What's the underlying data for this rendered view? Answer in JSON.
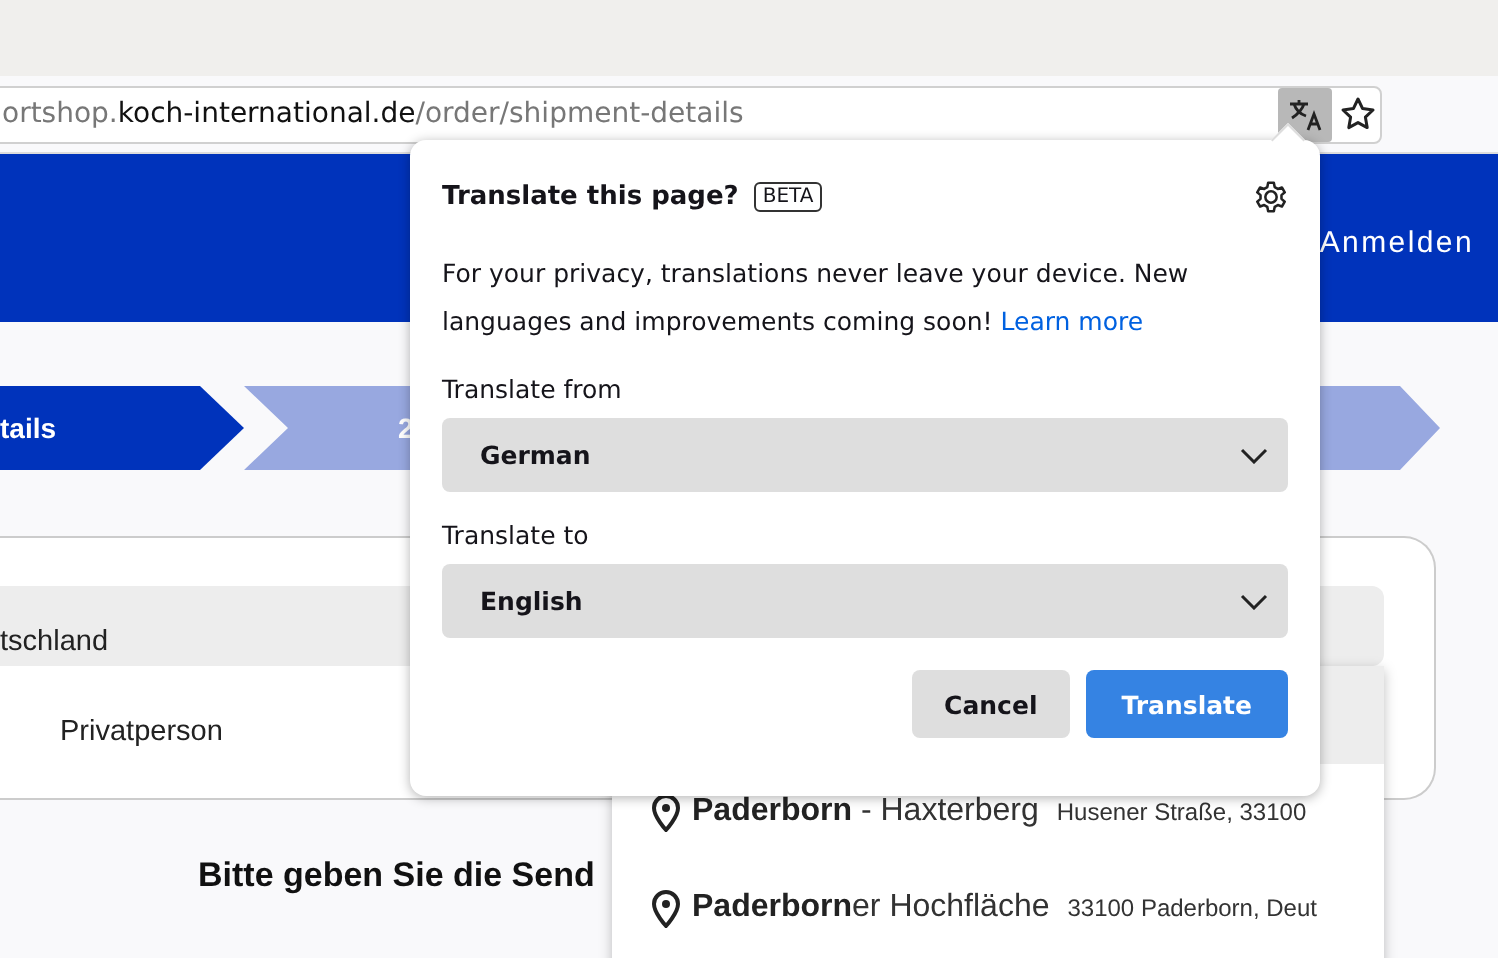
{
  "address_bar": {
    "url_prefix": "ortshop.",
    "url_domain": "koch-international.de",
    "url_path": "/order/shipment-details",
    "translate_active": true
  },
  "header": {
    "login": "Anmelden"
  },
  "steps": [
    {
      "label": "tails",
      "selected": true
    },
    {
      "label": "2",
      "selected": false
    }
  ],
  "form": {
    "country": "tschland",
    "customer_type": "Privatperson",
    "instruction": "Bitte geben Sie die Send"
  },
  "suggestions": [
    {
      "name": "**Paderborn** - Haxterberg",
      "address": "Husener Straße, 33100"
    },
    {
      "name": "**Paderborn**er Hochfläche",
      "address": "33100 Paderborn, Deut"
    }
  ],
  "translate_popup": {
    "title": "Translate this page?",
    "badge": "BETA",
    "message": "For your privacy, translations never leave your device. New languages and improvements coming soon!",
    "link": "Learn more",
    "from_label": "Translate from",
    "from_value": "German",
    "to_label": "Translate to",
    "to_value": "English",
    "buttons": [
      {
        "label": "Cancel",
        "kind": "secondary"
      },
      {
        "label": "Translate",
        "kind": "primary"
      }
    ]
  }
}
